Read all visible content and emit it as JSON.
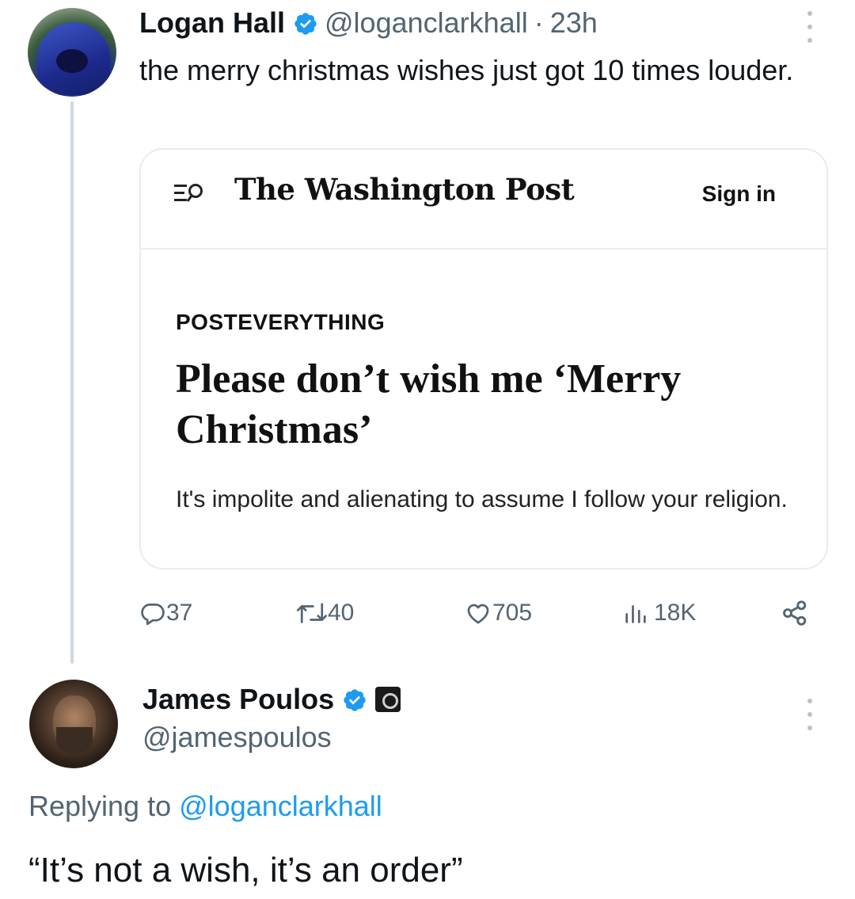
{
  "tweet": {
    "author_name": "Logan Hall",
    "handle": "@loganclarkhall",
    "separator": "·",
    "time": "23h",
    "text": "the merry christmas wishes just got 10 times louder.",
    "card": {
      "publication": "The Washington Post",
      "sign_in": "Sign in",
      "section": "POSTEVERYTHING",
      "headline": "Please don’t wish me ‘Merry Christmas’",
      "dek": "It's impolite and alienating to assume I follow your religion."
    },
    "actions": {
      "replies": "37",
      "retweets": "40",
      "likes": "705",
      "views": "18K"
    }
  },
  "reply": {
    "author_name": "James Poulos",
    "handle": "@jamespoulos",
    "replying_prefix": "Replying to",
    "replying_to": "@loganclarkhall",
    "text": "“It’s not a wish, it’s an order”"
  },
  "colors": {
    "verified": "#1d9bf0",
    "secondary_text": "#536471",
    "link": "#1d9bf0",
    "border": "#e7ecf0"
  },
  "icons": [
    "verified-icon",
    "more-icon",
    "menu-search-icon",
    "reply-icon",
    "retweet-icon",
    "like-icon",
    "views-icon",
    "share-icon",
    "affiliate-badge-icon"
  ]
}
